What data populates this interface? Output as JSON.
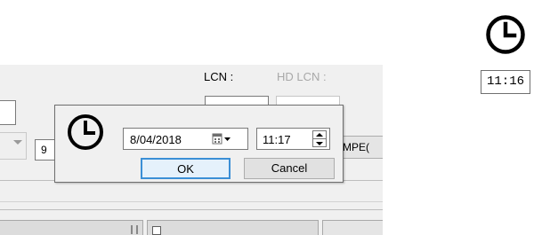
{
  "background_form": {
    "lcn_label": "LCN :",
    "hd_lcn_label": "HD LCN :",
    "partial_field_value": "9",
    "mpeg_value": "MPEG",
    "mpeg_partial_text": "MPE("
  },
  "popup": {
    "icon": "clock-icon",
    "date_value": "8/04/2018",
    "calendar_icon": "calendar-dropdown-icon",
    "time_value": "11:17",
    "ok_label": "OK",
    "cancel_label": "Cancel",
    "ok_border_color": "#3b8fd6"
  },
  "sample_widget": {
    "icon": "clock-icon",
    "time_value": "11:16"
  }
}
